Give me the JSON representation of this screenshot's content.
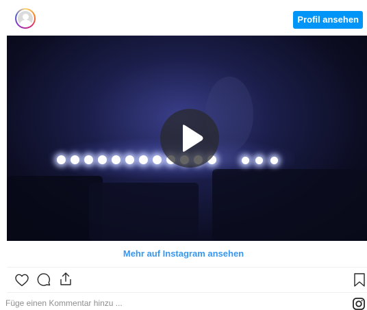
{
  "header": {
    "profile_button_label": "Profil ansehen",
    "avatar_icon": "avatar-icon"
  },
  "video": {
    "play_icon": "play-icon"
  },
  "footer": {
    "more_link_label": "Mehr auf Instagram ansehen",
    "comment_placeholder": "Füge einen Kommentar hinzu ...",
    "icons": {
      "like": "heart-icon",
      "comment": "comment-icon",
      "share": "share-icon",
      "save": "bookmark-icon",
      "instagram": "instagram-icon"
    }
  },
  "colors": {
    "accent": "#0095f6",
    "link": "#3897f0",
    "muted_text": "#8e8e8e",
    "icon": "#262626"
  }
}
